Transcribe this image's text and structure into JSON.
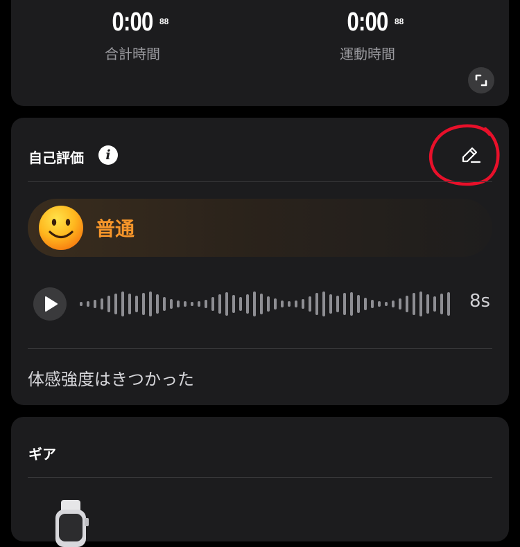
{
  "stats": [
    {
      "value": "0:00",
      "superscript": "88",
      "label": "合計時間"
    },
    {
      "value": "0:00",
      "superscript": "88",
      "label": "運動時間"
    }
  ],
  "evaluation": {
    "title": "自己評価",
    "info_glyph": "i",
    "mood": {
      "emoji": "smiling-face",
      "label": "普通"
    },
    "audio": {
      "duration": "8s"
    },
    "note": "体感強度はきつかった"
  },
  "gear": {
    "title": "ギア"
  },
  "colors": {
    "accent": "#f7962a",
    "annotation": "#e8102a",
    "card": "#1c1c1e"
  }
}
